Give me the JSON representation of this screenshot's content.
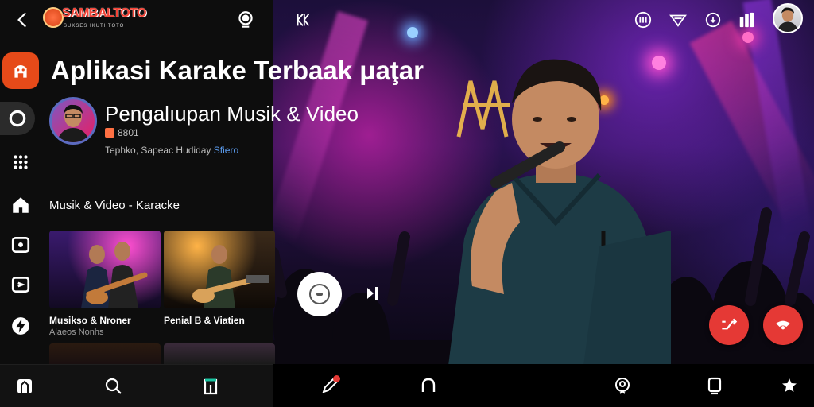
{
  "app": {
    "logo_title": "SAMBALTOTO",
    "logo_subtitle": "SUKSES IKUTI TOTO"
  },
  "header": {
    "headline": "Aplikasi Karake Terbaak μaţar"
  },
  "channel": {
    "name": "Pengalıupan Musik & Video",
    "meta": "8801",
    "tags_plain": "Tephko, Sapeac Hudiday ",
    "tags_link": "Sfiero"
  },
  "section": {
    "title": "Musik & Video - Karacke"
  },
  "cards": [
    {
      "title": "Musikso & Nroner",
      "subtitle": "Alaeos Nonhs"
    },
    {
      "title": "Penial B & Viatien",
      "subtitle": ""
    }
  ],
  "icons": {
    "back": "back-arrow-icon",
    "search": "search-icon",
    "rail": [
      "home-icon",
      "spinner-icon",
      "dots-grid-icon",
      "house-icon",
      "tv-icon",
      "cast-icon",
      "bolt-icon"
    ],
    "video_top": [
      "kk-icon",
      "subtitles-icon",
      "wifi-icon",
      "cast-refresh-icon",
      "equalizer-icon"
    ],
    "fab": [
      "shuffle-icon",
      "record-icon"
    ],
    "bottom_left": [
      "library-icon",
      "search-icon",
      "bookmark-icon"
    ],
    "bottom_right": [
      "draw-icon",
      "headphones-icon",
      "location-icon",
      "chat-icon",
      "star-icon"
    ]
  },
  "colors": {
    "accent": "#e53935",
    "home_tile": "#e64a19",
    "link": "#5c9df0"
  }
}
